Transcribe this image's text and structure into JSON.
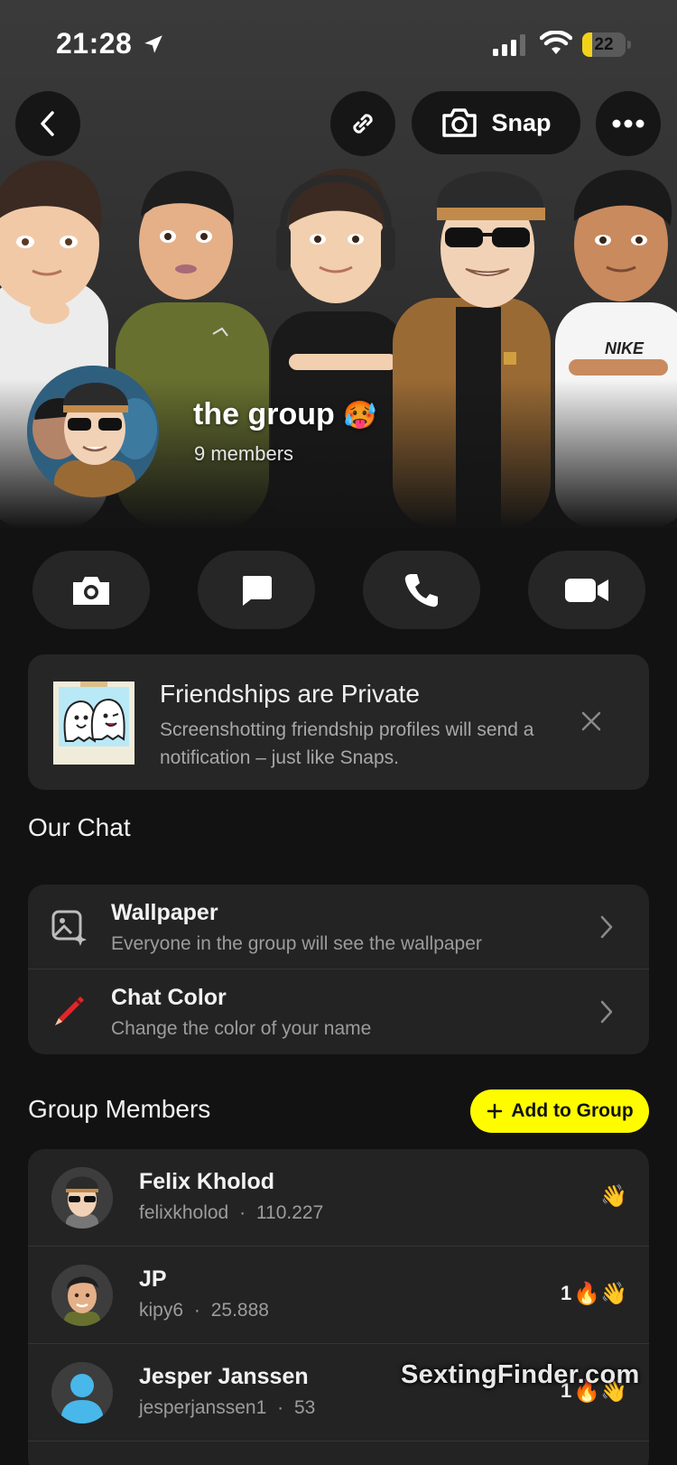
{
  "status_bar": {
    "time": "21:28",
    "battery": "22",
    "battery_level": 0.22,
    "icons": [
      "location-arrow-icon",
      "signal-icon",
      "wifi-icon",
      "battery-icon"
    ]
  },
  "header": {
    "back_icon": "chevron-left-icon",
    "link_icon": "link-icon",
    "snap_label": "Snap",
    "snap_icon": "camera-icon",
    "more_icon": "more-dots-icon",
    "group_name": "the group",
    "group_emoji": "🥵",
    "member_count": "9 members"
  },
  "actions": [
    {
      "name": "camera",
      "icon": "camera-icon"
    },
    {
      "name": "chat",
      "icon": "chat-bubble-icon"
    },
    {
      "name": "call",
      "icon": "phone-icon"
    },
    {
      "name": "video",
      "icon": "video-camera-icon"
    }
  ],
  "banner": {
    "title": "Friendships are Private",
    "body": "Screenshotting friendship profiles will send a notification – just like Snaps.",
    "close_icon": "close-icon"
  },
  "our_chat": {
    "title": "Our Chat",
    "items": [
      {
        "title": "Wallpaper",
        "subtitle": "Everyone in the group will see the wallpaper",
        "icon": "wallpaper-icon"
      },
      {
        "title": "Chat Color",
        "subtitle": "Change the color of your name",
        "icon": "crayon-icon"
      }
    ]
  },
  "group_members": {
    "title": "Group Members",
    "add_label": "Add to Group",
    "members": [
      {
        "name": "Felix Kholod",
        "username": "felixkholod",
        "score": "110.227",
        "streak": "",
        "emojis": "👋"
      },
      {
        "name": "JP",
        "username": "kipy6",
        "score": "25.888",
        "streak": "1",
        "emojis": "🔥👋"
      },
      {
        "name": "Jesper Janssen",
        "username": "jesperjanssen1",
        "score": "53",
        "streak": "1",
        "emojis": "🔥👋"
      }
    ]
  },
  "watermark": "SextingFinder.com",
  "colors": {
    "accent": "#fffc00",
    "background": "#121212",
    "card": "#232323"
  }
}
